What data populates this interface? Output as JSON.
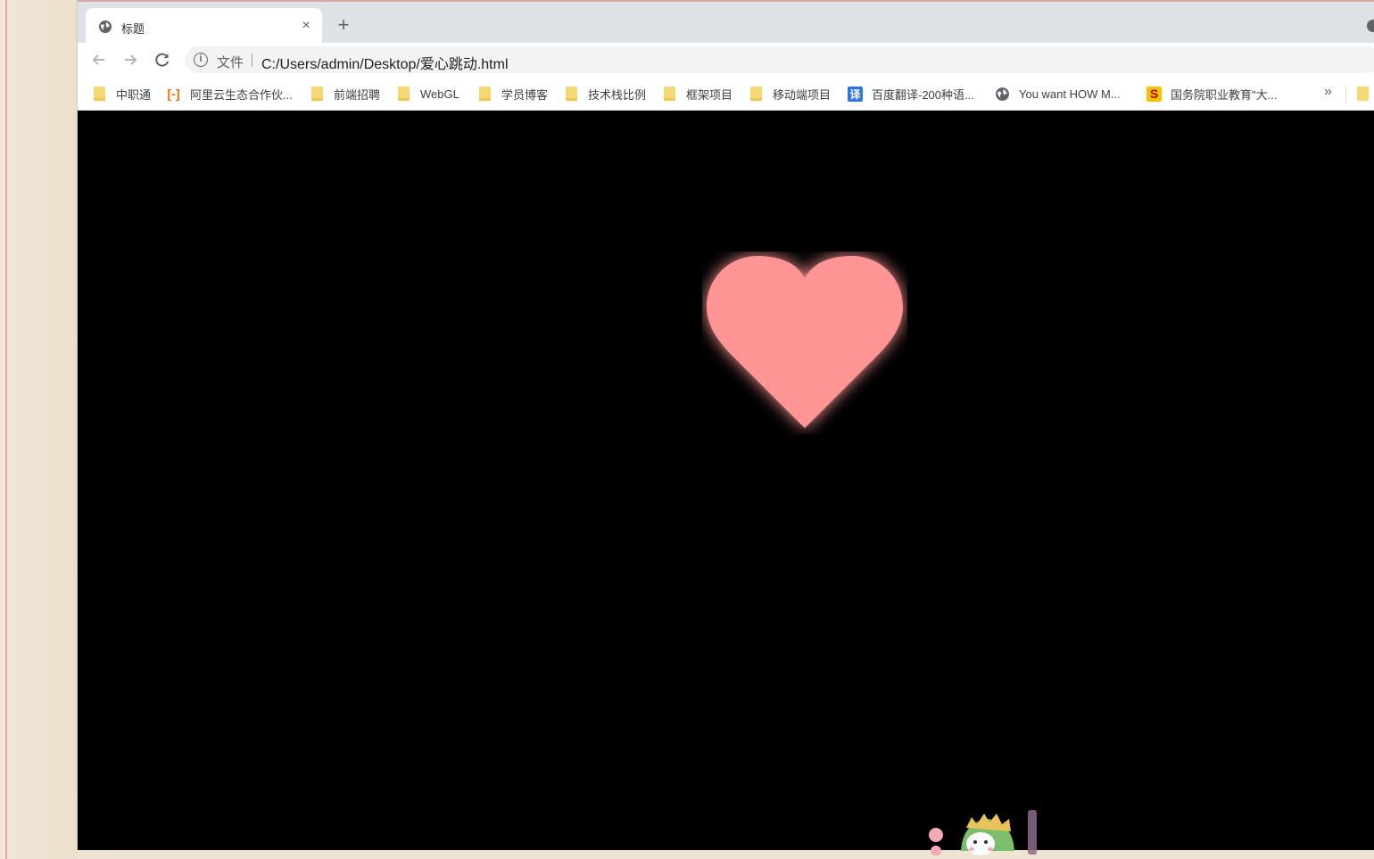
{
  "browser": {
    "tab": {
      "title": "标题",
      "icon": "globe-icon",
      "close_glyph": "×"
    },
    "new_tab_glyph": "+",
    "address": {
      "scheme_label": "文件",
      "url": "C:/Users/admin/Desktop/爱心跳动.html"
    },
    "bookmarks": [
      {
        "label": "中职通",
        "icon": "folder-icon"
      },
      {
        "label": "阿里云生态合作伙...",
        "icon": "aliyun-icon"
      },
      {
        "label": "前端招聘",
        "icon": "folder-icon"
      },
      {
        "label": "WebGL",
        "icon": "folder-icon"
      },
      {
        "label": "学员博客",
        "icon": "folder-icon"
      },
      {
        "label": "技术栈比例",
        "icon": "folder-icon"
      },
      {
        "label": "框架项目",
        "icon": "folder-icon"
      },
      {
        "label": "移动端项目",
        "icon": "folder-icon"
      },
      {
        "label": "百度翻译-200种语...",
        "icon": "baidu-translate-icon"
      },
      {
        "label": "You want HOW M...",
        "icon": "globe-icon"
      },
      {
        "label": "国务院职业教育\"大...",
        "icon": "s-icon"
      }
    ],
    "bookmarks_overflow_glyph": "»"
  },
  "page": {
    "heart_color": "#ff9494",
    "heart_glow": "#ffb0a8",
    "background": "#000000"
  },
  "colors": {
    "tabstrip": "#dee1e6",
    "folder": "#f8d775"
  }
}
